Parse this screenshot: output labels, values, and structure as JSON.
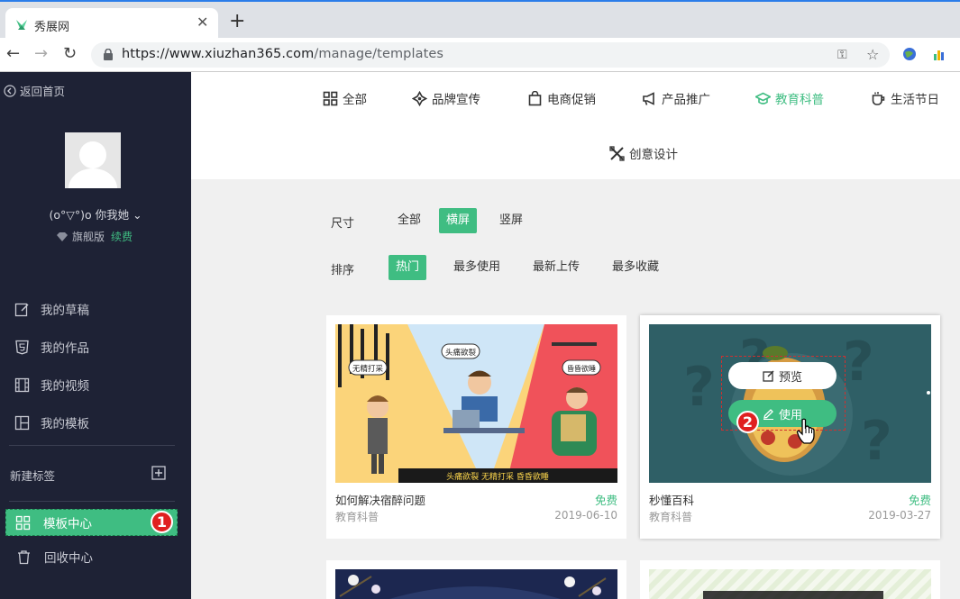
{
  "browser": {
    "tab_title": "秀展网",
    "url_host": "https://www.xiuzhan365.com",
    "url_path": "/manage/templates"
  },
  "sidebar": {
    "back_label": "返回首页",
    "username": "(o°▽°)o 你我她",
    "edition": "旗舰版",
    "renew": "续费",
    "items": [
      {
        "label": "我的草稿",
        "icon": "draft-icon"
      },
      {
        "label": "我的作品",
        "icon": "html5-icon"
      },
      {
        "label": "我的视频",
        "icon": "film-icon"
      },
      {
        "label": "我的模板",
        "icon": "layout-icon"
      }
    ],
    "new_tag": "新建标签",
    "template_center": "模板中心",
    "recycle": "回收中心",
    "badge_1": "1"
  },
  "categories": [
    {
      "label": "全部",
      "icon": "grid-icon",
      "active": false
    },
    {
      "label": "品牌宣传",
      "icon": "brand-icon",
      "active": false
    },
    {
      "label": "电商促销",
      "icon": "shopping-bag-icon",
      "active": false
    },
    {
      "label": "产品推广",
      "icon": "megaphone-icon",
      "active": false
    },
    {
      "label": "教育科普",
      "icon": "graduation-cap-icon",
      "active": true
    },
    {
      "label": "生活节日",
      "icon": "cup-icon",
      "active": false
    },
    {
      "label": "创意设计",
      "icon": "tools-icon",
      "active": false
    }
  ],
  "filters": {
    "size_label": "尺寸",
    "size_options": [
      "全部",
      "横屏",
      "竖屏"
    ],
    "size_selected": "横屏",
    "sort_label": "排序",
    "sort_options": [
      "热门",
      "最多使用",
      "最新上传",
      "最多收藏"
    ],
    "sort_selected": "热门"
  },
  "cards": [
    {
      "title": "如何解决宿醉问题",
      "price": "免费",
      "category": "教育科普",
      "date": "2019-06-10",
      "thumb_texts": [
        "无精打采",
        "头痛欲裂",
        "昏昏欲睡",
        "头痛欲裂 无精打采 昏昏欲睡"
      ]
    },
    {
      "title": "秒懂百科",
      "price": "免费",
      "category": "教育科普",
      "date": "2019-03-27",
      "preview_label": "预览",
      "use_label": "使用",
      "badge": "2"
    }
  ],
  "colors": {
    "accent": "#3fbd82",
    "sidebar_bg": "#1e2235",
    "badge": "#e02020"
  }
}
